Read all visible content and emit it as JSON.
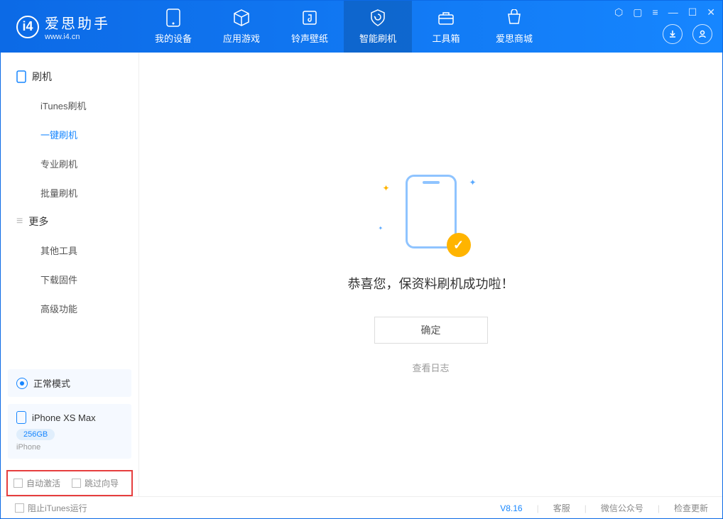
{
  "app": {
    "name": "爱思助手",
    "url": "www.i4.cn"
  },
  "tabs": [
    {
      "label": "我的设备",
      "icon": "device"
    },
    {
      "label": "应用游戏",
      "icon": "cube"
    },
    {
      "label": "铃声壁纸",
      "icon": "music"
    },
    {
      "label": "智能刷机",
      "icon": "shield",
      "active": true
    },
    {
      "label": "工具箱",
      "icon": "toolbox"
    },
    {
      "label": "爱思商城",
      "icon": "shop"
    }
  ],
  "sidebar": {
    "group_flash": "刷机",
    "items_flash": [
      "iTunes刷机",
      "一键刷机",
      "专业刷机",
      "批量刷机"
    ],
    "active_flash_index": 1,
    "group_more": "更多",
    "items_more": [
      "其他工具",
      "下载固件",
      "高级功能"
    ]
  },
  "mode": {
    "label": "正常模式"
  },
  "device": {
    "name": "iPhone XS Max",
    "storage": "256GB",
    "type": "iPhone"
  },
  "checks": {
    "auto_activate": "自动激活",
    "skip_guide": "跳过向导"
  },
  "main": {
    "message": "恭喜您，保资料刷机成功啦！",
    "ok": "确定",
    "view_log": "查看日志"
  },
  "footer": {
    "block_itunes": "阻止iTunes运行",
    "version": "V8.16",
    "links": [
      "客服",
      "微信公众号",
      "检查更新"
    ]
  }
}
